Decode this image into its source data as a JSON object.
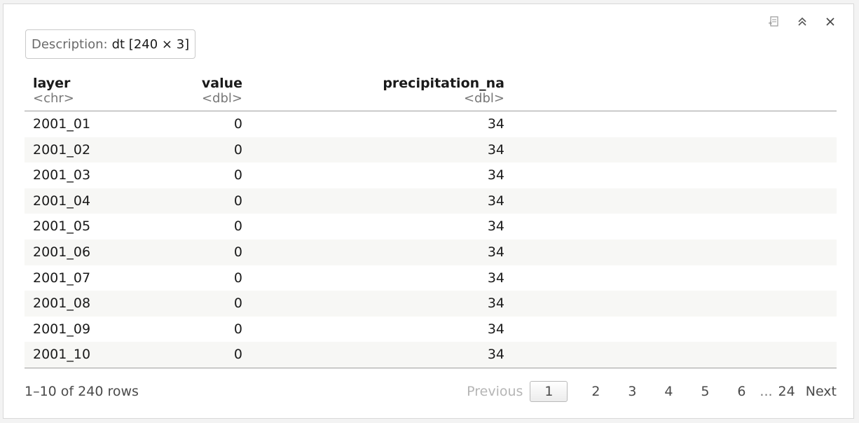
{
  "toolbar": {
    "icons": [
      "export-icon",
      "collapse-icon",
      "close-icon"
    ]
  },
  "description": {
    "label": "Description:",
    "value": "dt [240 × 3]"
  },
  "columns": [
    {
      "name": "layer",
      "type": "<chr>"
    },
    {
      "name": "value",
      "type": "<dbl>"
    },
    {
      "name": "precipitation_na",
      "type": "<dbl>"
    }
  ],
  "rows": [
    [
      "2001_01",
      "0",
      "34"
    ],
    [
      "2001_02",
      "0",
      "34"
    ],
    [
      "2001_03",
      "0",
      "34"
    ],
    [
      "2001_04",
      "0",
      "34"
    ],
    [
      "2001_05",
      "0",
      "34"
    ],
    [
      "2001_06",
      "0",
      "34"
    ],
    [
      "2001_07",
      "0",
      "34"
    ],
    [
      "2001_08",
      "0",
      "34"
    ],
    [
      "2001_09",
      "0",
      "34"
    ],
    [
      "2001_10",
      "0",
      "34"
    ]
  ],
  "footer": {
    "rows_info": "1–10 of 240 rows",
    "previous": "Previous",
    "pages": [
      "1",
      "2",
      "3",
      "4",
      "5",
      "6"
    ],
    "ellipsis": "...",
    "last_page": "24",
    "next": "Next",
    "current_page": "1"
  },
  "colors": {
    "row_alt": "#f7f7f5",
    "disabled_text": "#b5b5b5"
  }
}
